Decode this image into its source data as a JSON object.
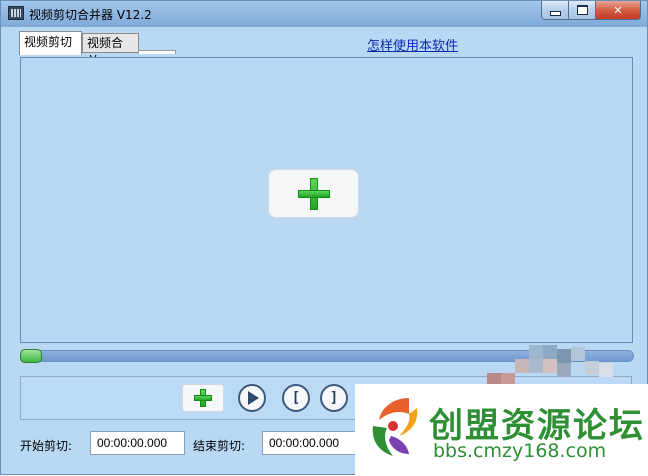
{
  "window": {
    "title": "视频剪切合并器 V12.2",
    "controls": {
      "minimize": "minimize",
      "maximize": "maximize",
      "close": "✕"
    }
  },
  "tabs": [
    {
      "label": "视频剪切",
      "active": true
    },
    {
      "label": "视频合并",
      "active": false
    }
  ],
  "help_link": "怎样使用本软件",
  "video_panel": {
    "add_icon": "plus-icon"
  },
  "progress": {
    "value": 0.0
  },
  "controls": [
    {
      "name": "add",
      "icon": "plus-icon"
    },
    {
      "name": "play",
      "icon": "play-icon"
    },
    {
      "name": "mark-in",
      "icon": "["
    },
    {
      "name": "mark-out",
      "icon": "]"
    }
  ],
  "cut": {
    "start_label": "开始剪切:",
    "start_value": "00:00:00.000",
    "end_label": "结束剪切:",
    "end_value": "00:00:00.000"
  },
  "watermark": {
    "title": "创盟资源论坛",
    "url": "bbs.cmzy168.com"
  },
  "colors": {
    "window_bg": "#b9d8f4",
    "accent_green": "#2e8f35",
    "link_blue": "#0a2aa8"
  }
}
